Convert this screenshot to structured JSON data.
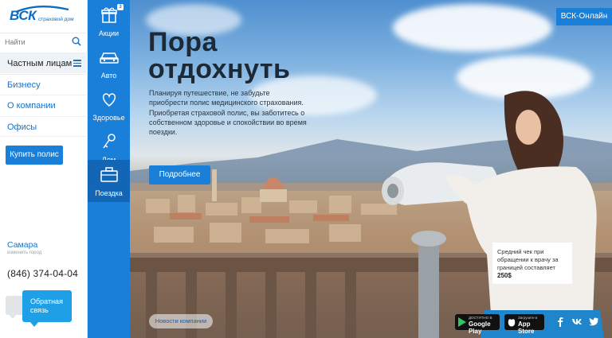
{
  "brand": {
    "logo": "ВСК",
    "subtitle": "страховой дом"
  },
  "search": {
    "placeholder": "Найти"
  },
  "sidebar": {
    "items": [
      {
        "label": "Частным лицам"
      },
      {
        "label": "Бизнесу"
      },
      {
        "label": "О компании"
      },
      {
        "label": "Офисы"
      }
    ],
    "buy_label": "Купить полис",
    "city": "Самара",
    "city_hint": "изменить город",
    "phone": "(846) 374-04-04",
    "feedback": "Обратная связь"
  },
  "rail": {
    "items": [
      {
        "label": "Акции",
        "icon": "gift-icon",
        "badge": "3"
      },
      {
        "label": "Авто",
        "icon": "car-icon"
      },
      {
        "label": "Здоровье",
        "icon": "heart-icon"
      },
      {
        "label": "Дом",
        "icon": "key-icon"
      },
      {
        "label": "Поездка",
        "icon": "suitcase-icon"
      }
    ]
  },
  "hero": {
    "title": "Пора отдохнуть",
    "text": "Планируя путешествие, не забудьте приобрести полис медицинского страхования. Приобретая страховой полис, вы заботитесь о собственном здоровье и спокойствии во время поездки.",
    "button": "Подробнее",
    "online": "ВСК-Онлайн",
    "card_text": "Средний чек при обращении к врачу за границей составляет",
    "card_value": "250$",
    "news": "Новости компании",
    "google_top": "ДОСТУПНО В",
    "google_name": "Google Play",
    "apple_top": "Загрузите в",
    "apple_name": "App Store"
  },
  "colors": {
    "accent": "#1a7fd8",
    "accent_dark": "#1366b6",
    "feedback": "#1fa0e6"
  }
}
